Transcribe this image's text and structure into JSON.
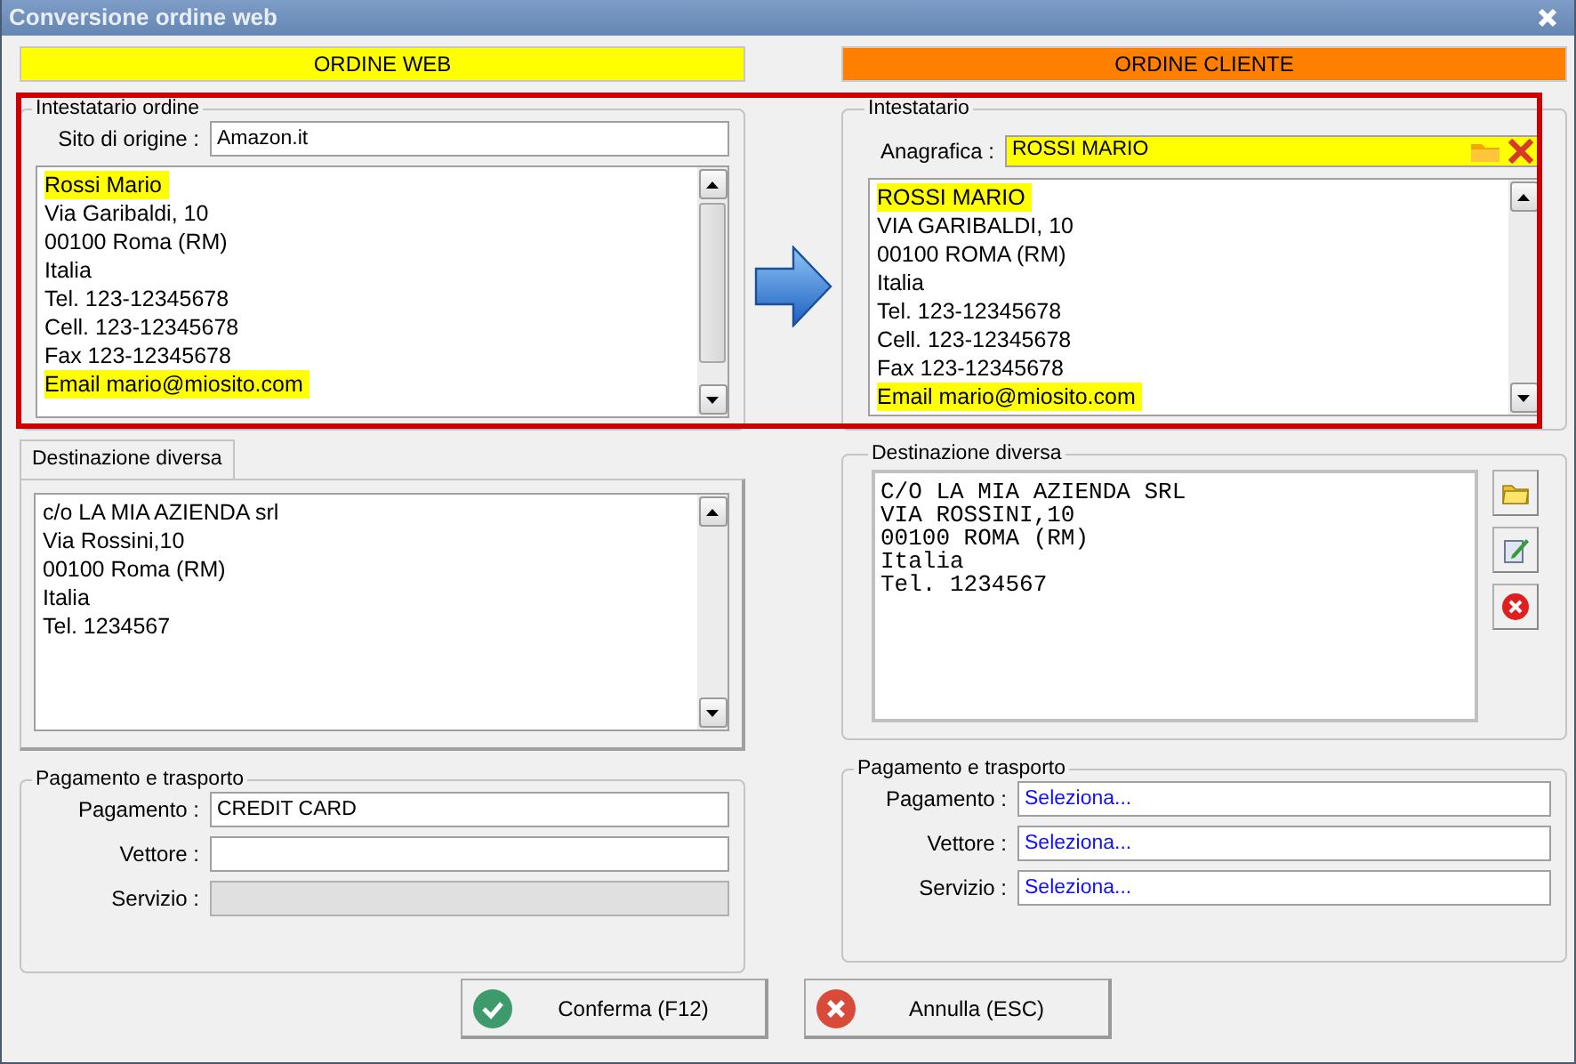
{
  "window": {
    "title": "Conversione ordine web"
  },
  "web_order": {
    "header": "ORDINE WEB",
    "holder": {
      "legend": "Intestatario ordine",
      "site": {
        "label": "Sito di origine :",
        "value": "Amazon.it"
      },
      "address": [
        {
          "text": "Rossi Mario",
          "highlighted": true
        },
        {
          "text": "Via Garibaldi, 10",
          "highlighted": false
        },
        {
          "text": "00100 Roma (RM)",
          "highlighted": false
        },
        {
          "text": "Italia",
          "highlighted": false
        },
        {
          "text": "Tel. 123-12345678",
          "highlighted": false
        },
        {
          "text": "Cell. 123-12345678",
          "highlighted": false
        },
        {
          "text": "Fax 123-12345678",
          "highlighted": false
        },
        {
          "text": "Email mario@miosito.com",
          "highlighted": true
        }
      ]
    },
    "destination": {
      "tab": "Destinazione diversa",
      "address": [
        "c/o LA MIA AZIENDA srl",
        "Via Rossini,10",
        "00100 Roma (RM)",
        "Italia",
        "Tel. 1234567"
      ]
    },
    "payment": {
      "legend": "Pagamento e trasporto",
      "fields": [
        {
          "label": "Pagamento :",
          "value": "CREDIT CARD",
          "disabled": false
        },
        {
          "label": "Vettore :",
          "disabled": false
        },
        {
          "label": "Servizio :",
          "disabled": true
        }
      ]
    }
  },
  "client_order": {
    "header": "ORDINE CLIENTE",
    "holder": {
      "legend": "Intestatario",
      "registry": {
        "label": "Anagrafica :",
        "value": "ROSSI MARIO"
      },
      "address": [
        {
          "text": "ROSSI MARIO",
          "highlighted": true
        },
        {
          "text": "VIA GARIBALDI, 10",
          "highlighted": false
        },
        {
          "text": "00100 ROMA (RM)",
          "highlighted": false
        },
        {
          "text": "Italia",
          "highlighted": false
        },
        {
          "text": "Tel. 123-12345678",
          "highlighted": false
        },
        {
          "text": "Cell. 123-12345678",
          "highlighted": false
        },
        {
          "text": "Fax 123-12345678",
          "highlighted": false
        },
        {
          "text": "Email mario@miosito.com",
          "highlighted": true
        }
      ]
    },
    "destination": {
      "legend": "Destinazione diversa",
      "address": [
        "C/O LA MIA AZIENDA SRL",
        "VIA ROSSINI,10",
        "00100 ROMA (RM)",
        "Italia",
        "Tel. 1234567"
      ]
    },
    "payment": {
      "legend": "Pagamento e trasporto",
      "fields": [
        {
          "label": "Pagamento :",
          "placeholder": "Seleziona...",
          "disabled": false
        },
        {
          "label": "Vettore :",
          "placeholder": "Seleziona...",
          "disabled": false
        },
        {
          "label": "Servizio :",
          "placeholder": "Seleziona...",
          "disabled": false
        }
      ]
    }
  },
  "buttons": [
    {
      "label": "Conferma (F12)",
      "kind": "confirm"
    },
    {
      "label": "Annulla (ESC)",
      "kind": "cancel"
    }
  ]
}
